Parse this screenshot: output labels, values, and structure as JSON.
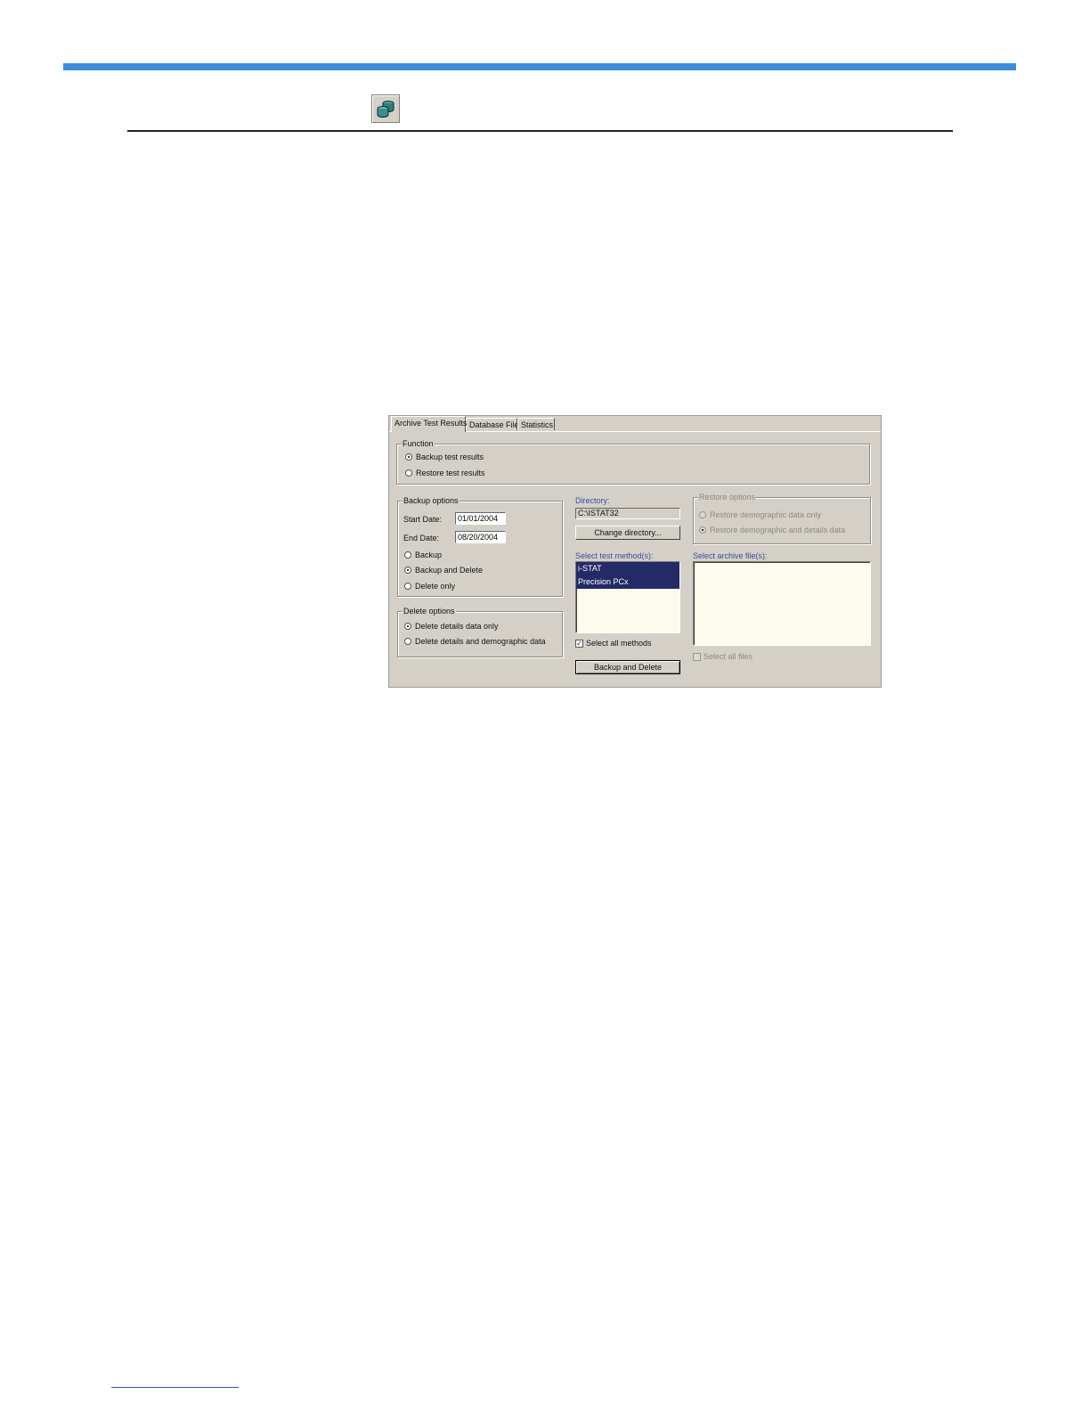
{
  "tabs": [
    "Archive Test Results",
    "Database File",
    "Statistics"
  ],
  "function_group": {
    "label": "Function",
    "options": [
      "Backup test results",
      "Restore test results"
    ],
    "selected": 0
  },
  "backup_options": {
    "label": "Backup options",
    "start_date_label": "Start Date:",
    "start_date": "01/01/2004",
    "end_date_label": "End Date:",
    "end_date": "08/20/2004",
    "modes": [
      "Backup",
      "Backup and Delete",
      "Delete only"
    ],
    "selected": 1
  },
  "delete_options": {
    "label": "Delete options",
    "options": [
      "Delete details data only",
      "Delete details and demographic data"
    ],
    "selected": 0
  },
  "directory": {
    "label": "Directory:",
    "value": "C:\\ISTAT32",
    "change_button": "Change directory..."
  },
  "test_methods": {
    "label": "Select test method(s):",
    "items": [
      "i-STAT",
      "Precision PCx"
    ],
    "select_all_label": "Select all methods",
    "select_all_checked": true
  },
  "action_button": "Backup and Delete",
  "restore_options": {
    "label": "Restore options",
    "options": [
      "Restore demographic data only",
      "Restore demographic and details data"
    ],
    "selected": 1
  },
  "archive_files": {
    "label": "Select archive file(s):",
    "select_all_label": "Select all files",
    "select_all_checked": false
  }
}
